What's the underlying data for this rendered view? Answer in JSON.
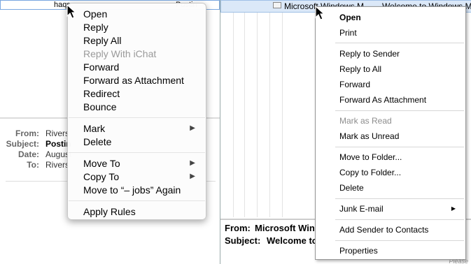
{
  "mac": {
    "row": {
      "col1": "haqs",
      "col2": "Postin"
    },
    "headers": [
      {
        "label": "From:",
        "value": "Rivers"
      },
      {
        "label": "Subject:",
        "value": "Postin"
      },
      {
        "label": "Date:",
        "value": "August"
      },
      {
        "label": "To:",
        "value": "Rivers"
      }
    ],
    "menu": {
      "groups": [
        [
          "Open",
          "Reply",
          "Reply All",
          "Reply With iChat",
          "Forward",
          "Forward as Attachment",
          "Redirect",
          "Bounce"
        ],
        [
          "Mark",
          "Delete"
        ],
        [
          "Move To",
          "Copy To",
          "Move to “– jobs” Again"
        ],
        [
          "Apply Rules"
        ]
      ],
      "disabled": [
        "Reply With iChat"
      ],
      "submenu_arrow": "▶"
    }
  },
  "win": {
    "row": {
      "sender": "Microsoft Windows M",
      "subject": "Welcome to Windows M"
    },
    "preview": {
      "from_label": "From:",
      "from_value": "Microsoft Win",
      "subject_label": "Subject:",
      "subject_value": "Welcome to"
    },
    "menu": {
      "items": [
        "Open",
        "Print",
        "Reply to Sender",
        "Reply to All",
        "Forward",
        "Forward As Attachment",
        "Mark as Read",
        "Mark as Unread",
        "Move to Folder...",
        "Copy to Folder...",
        "Delete",
        "Junk E-mail",
        "Add Sender to Contacts",
        "Properties"
      ],
      "submenu_arrow": "▶"
    },
    "corner_text": "Please"
  },
  "colors": {
    "mac_selection_border": "#7aa7e0",
    "win_selection_bg": "#dbe8f8",
    "disabled_text": "#9a9a9a"
  }
}
